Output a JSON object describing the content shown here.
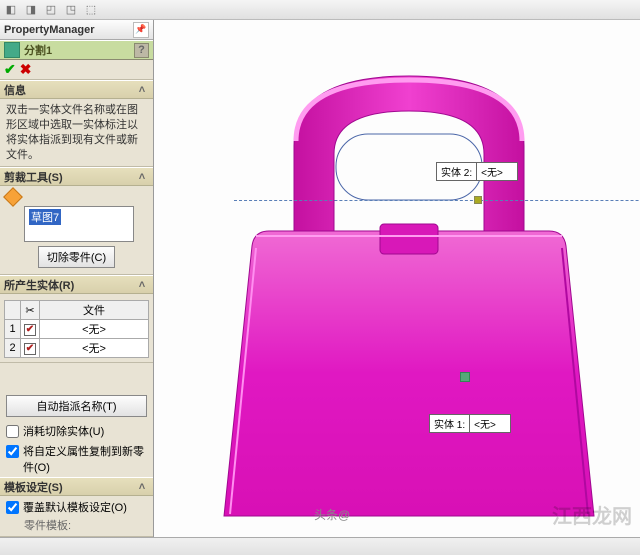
{
  "header": {
    "title": "PropertyManager"
  },
  "feature": {
    "name": "分割1",
    "help": "?"
  },
  "sections": {
    "info": {
      "title": "信息",
      "text": "双击一实体文件名称或在图形区域中选取一实体标注以将实体指派到现有文件或新文件。"
    },
    "trim": {
      "title": "剪裁工具(S)",
      "sketch": "草图7",
      "cut_button": "切除零件(C)"
    },
    "bodies": {
      "title": "所产生实体(R)",
      "file_header": "文件",
      "rows": [
        {
          "idx": "1",
          "checked": true,
          "file": "<无>"
        },
        {
          "idx": "2",
          "checked": true,
          "file": "<无>"
        }
      ],
      "auto_name": "自动指派名称(T)",
      "consume": "消耗切除实体(U)",
      "copy_props": "将自定义属性复制到新零件(O)"
    },
    "template": {
      "title": "模板设定(S)",
      "override": "覆盖默认模板设定(O)",
      "subtext": "零件模板:"
    }
  },
  "viewport": {
    "body_label_prefix_1": "实体 1:",
    "body_label_prefix_2": "实体 2:",
    "body_label_value": "<无>"
  },
  "watermark": {
    "left": "头条@",
    "right": "江西龙网"
  }
}
